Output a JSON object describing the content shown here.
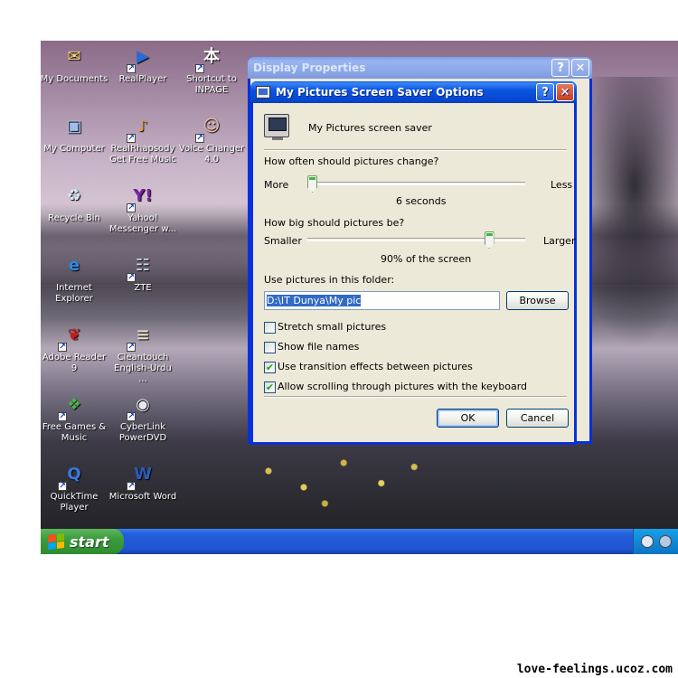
{
  "desktop": {
    "icons": [
      {
        "label": "My Documents",
        "icon": "my-documents-icon",
        "glyph": "✉",
        "color": "#f4d36a"
      },
      {
        "label": "RealPlayer",
        "icon": "realplayer-icon",
        "glyph": "▶",
        "color": "#2a6ad8"
      },
      {
        "label": "Shortcut to INPAGE",
        "icon": "inpage-icon",
        "glyph": "本",
        "color": "#ffffff"
      },
      {
        "label": "My Computer",
        "icon": "my-computer-icon",
        "glyph": "▣",
        "color": "#9fc0ee"
      },
      {
        "label": "RealRhapsody Get Free Music",
        "icon": "realrhapsody-icon",
        "glyph": "♪",
        "color": "#e0a040"
      },
      {
        "label": "Voice Changer 4.0",
        "icon": "voice-changer-icon",
        "glyph": "☺",
        "color": "#f0c0a0"
      },
      {
        "label": "Recycle Bin",
        "icon": "recycle-bin-icon",
        "glyph": "♻",
        "color": "#d8e8f8"
      },
      {
        "label": "Yahoo! Messenger w...",
        "icon": "yahoo-messenger-icon",
        "glyph": "Y!",
        "color": "#7b1fa2"
      },
      {
        "label": "Internet Explorer",
        "icon": "internet-explorer-icon",
        "glyph": "e",
        "color": "#2a8ae8"
      },
      {
        "label": "ZTE",
        "icon": "zte-icon",
        "glyph": "☷",
        "color": "#c8d8e8"
      },
      {
        "label": "Adobe Reader 9",
        "icon": "adobe-reader-icon",
        "glyph": "❦",
        "color": "#cc1a1a"
      },
      {
        "label": "Cleantouch English-Urdu ...",
        "icon": "cleantouch-dictionary-icon",
        "glyph": "≡",
        "color": "#e8e0c8"
      },
      {
        "label": "Free Games & Music",
        "icon": "free-games-icon",
        "glyph": "❖",
        "color": "#4caf50"
      },
      {
        "label": "CyberLink PowerDVD",
        "icon": "powerdvd-icon",
        "glyph": "◉",
        "color": "#e8e8f0"
      },
      {
        "label": "QuickTime Player",
        "icon": "quicktime-icon",
        "glyph": "Q",
        "color": "#3a7ae0"
      },
      {
        "label": "Microsoft Word",
        "icon": "microsoft-word-icon",
        "glyph": "W",
        "color": "#2b5cb8"
      }
    ]
  },
  "taskbar": {
    "start_label": "start",
    "tray_icons": [
      "volume-icon",
      "network-icon"
    ]
  },
  "display_properties": {
    "title": "Display Properties",
    "help_glyph": "?",
    "close_glyph": "✕"
  },
  "dialog": {
    "title": "My Pictures Screen Saver Options",
    "help_glyph": "?",
    "close_glyph": "✕",
    "header_text": "My Pictures screen saver",
    "change_question": "How often should pictures change?",
    "change_min_label": "More",
    "change_max_label": "Less",
    "change_value_text": "6 seconds",
    "change_level": 0.0,
    "size_question": "How big should pictures be?",
    "size_min_label": "Smaller",
    "size_max_label": "Larger",
    "size_value_text": "90% of the screen",
    "size_level": 0.85,
    "folder_label": "Use pictures in this folder:",
    "folder_value": "D:\\IT Dunya\\My pic",
    "browse_label": "Browse",
    "options": [
      {
        "label": "Stretch small pictures",
        "checked": false
      },
      {
        "label": "Show file names",
        "checked": false
      },
      {
        "label": "Use transition effects between pictures",
        "checked": true
      },
      {
        "label": "Allow scrolling through pictures with the keyboard",
        "checked": true
      }
    ],
    "ok_label": "OK",
    "cancel_label": "Cancel"
  },
  "watermark": "love-feelings.ucoz.com"
}
